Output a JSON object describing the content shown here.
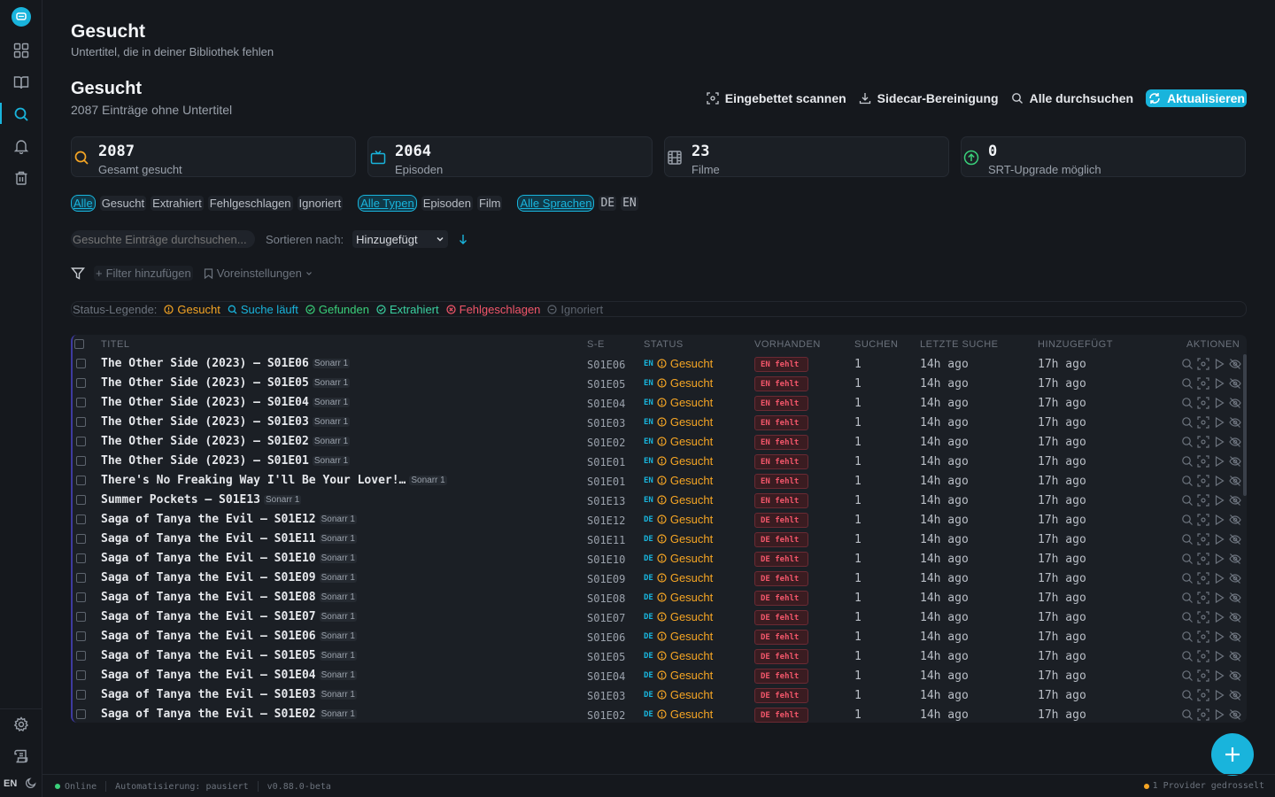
{
  "header": {
    "title": "Gesucht",
    "subtitle": "Untertitel, die in deiner Bibliothek fehlen"
  },
  "section": {
    "title": "Gesucht",
    "subtitle": "2087 Einträge ohne Untertitel"
  },
  "toolbar": {
    "scan_embedded": "Eingebettet scannen",
    "sidecar_cleanup": "Sidecar-Bereinigung",
    "search_all": "Alle durchsuchen",
    "refresh": "Aktualisieren"
  },
  "stats": [
    {
      "value": "2087",
      "label": "Gesamt gesucht"
    },
    {
      "value": "2064",
      "label": "Episoden"
    },
    {
      "value": "23",
      "label": "Filme"
    },
    {
      "value": "0",
      "label": "SRT-Upgrade möglich"
    }
  ],
  "filters": {
    "status": [
      "Alle",
      "Gesucht",
      "Extrahiert",
      "Fehlgeschlagen",
      "Ignoriert"
    ],
    "types": [
      "Alle Typen",
      "Episoden",
      "Film"
    ],
    "languages": [
      "Alle Sprachen",
      "DE",
      "EN"
    ]
  },
  "search": {
    "placeholder": "Gesuchte Einträge durchsuchen...",
    "sort_label": "Sortieren nach:",
    "sort_value": "Hinzugefügt"
  },
  "filterbar": {
    "add_filter": "Filter hinzufügen",
    "presets": "Voreinstellungen"
  },
  "legend": {
    "label": "Status-Legende:",
    "items": [
      {
        "label": "Gesucht",
        "color": "#f5a524"
      },
      {
        "label": "Suche läuft",
        "color": "#19b4dc"
      },
      {
        "label": "Gefunden",
        "color": "#3ad07a"
      },
      {
        "label": "Extrahiert",
        "color": "#3ad0a0"
      },
      {
        "label": "Fehlgeschlagen",
        "color": "#f2566a"
      },
      {
        "label": "Ignoriert",
        "color": "#5d646e"
      }
    ]
  },
  "table": {
    "columns": [
      "TITEL",
      "S-E",
      "STATUS",
      "VORHANDEN",
      "SUCHEN",
      "LETZTE SUCHE",
      "HINZUGEFÜGT",
      "AKTIONEN"
    ],
    "rows": [
      {
        "title": "The Other Side (2023) – S01E06",
        "source": "Sonarr 1",
        "se": "S01E06",
        "lang": "EN",
        "status": "Gesucht",
        "present": "EN fehlt",
        "searches": "1",
        "last": "14h ago",
        "added": "17h ago"
      },
      {
        "title": "The Other Side (2023) – S01E05",
        "source": "Sonarr 1",
        "se": "S01E05",
        "lang": "EN",
        "status": "Gesucht",
        "present": "EN fehlt",
        "searches": "1",
        "last": "14h ago",
        "added": "17h ago"
      },
      {
        "title": "The Other Side (2023) – S01E04",
        "source": "Sonarr 1",
        "se": "S01E04",
        "lang": "EN",
        "status": "Gesucht",
        "present": "EN fehlt",
        "searches": "1",
        "last": "14h ago",
        "added": "17h ago"
      },
      {
        "title": "The Other Side (2023) – S01E03",
        "source": "Sonarr 1",
        "se": "S01E03",
        "lang": "EN",
        "status": "Gesucht",
        "present": "EN fehlt",
        "searches": "1",
        "last": "14h ago",
        "added": "17h ago"
      },
      {
        "title": "The Other Side (2023) – S01E02",
        "source": "Sonarr 1",
        "se": "S01E02",
        "lang": "EN",
        "status": "Gesucht",
        "present": "EN fehlt",
        "searches": "1",
        "last": "14h ago",
        "added": "17h ago"
      },
      {
        "title": "The Other Side (2023) – S01E01",
        "source": "Sonarr 1",
        "se": "S01E01",
        "lang": "EN",
        "status": "Gesucht",
        "present": "EN fehlt",
        "searches": "1",
        "last": "14h ago",
        "added": "17h ago"
      },
      {
        "title": "There's No Freaking Way I'll Be Your Lover!…",
        "source": "Sonarr 1",
        "se": "S01E01",
        "lang": "EN",
        "status": "Gesucht",
        "present": "EN fehlt",
        "searches": "1",
        "last": "14h ago",
        "added": "17h ago"
      },
      {
        "title": "Summer Pockets – S01E13",
        "source": "Sonarr 1",
        "se": "S01E13",
        "lang": "EN",
        "status": "Gesucht",
        "present": "EN fehlt",
        "searches": "1",
        "last": "14h ago",
        "added": "17h ago"
      },
      {
        "title": "Saga of Tanya the Evil – S01E12",
        "source": "Sonarr 1",
        "se": "S01E12",
        "lang": "DE",
        "status": "Gesucht",
        "present": "DE fehlt",
        "searches": "1",
        "last": "14h ago",
        "added": "17h ago"
      },
      {
        "title": "Saga of Tanya the Evil – S01E11",
        "source": "Sonarr 1",
        "se": "S01E11",
        "lang": "DE",
        "status": "Gesucht",
        "present": "DE fehlt",
        "searches": "1",
        "last": "14h ago",
        "added": "17h ago"
      },
      {
        "title": "Saga of Tanya the Evil – S01E10",
        "source": "Sonarr 1",
        "se": "S01E10",
        "lang": "DE",
        "status": "Gesucht",
        "present": "DE fehlt",
        "searches": "1",
        "last": "14h ago",
        "added": "17h ago"
      },
      {
        "title": "Saga of Tanya the Evil – S01E09",
        "source": "Sonarr 1",
        "se": "S01E09",
        "lang": "DE",
        "status": "Gesucht",
        "present": "DE fehlt",
        "searches": "1",
        "last": "14h ago",
        "added": "17h ago"
      },
      {
        "title": "Saga of Tanya the Evil – S01E08",
        "source": "Sonarr 1",
        "se": "S01E08",
        "lang": "DE",
        "status": "Gesucht",
        "present": "DE fehlt",
        "searches": "1",
        "last": "14h ago",
        "added": "17h ago"
      },
      {
        "title": "Saga of Tanya the Evil – S01E07",
        "source": "Sonarr 1",
        "se": "S01E07",
        "lang": "DE",
        "status": "Gesucht",
        "present": "DE fehlt",
        "searches": "1",
        "last": "14h ago",
        "added": "17h ago"
      },
      {
        "title": "Saga of Tanya the Evil – S01E06",
        "source": "Sonarr 1",
        "se": "S01E06",
        "lang": "DE",
        "status": "Gesucht",
        "present": "DE fehlt",
        "searches": "1",
        "last": "14h ago",
        "added": "17h ago"
      },
      {
        "title": "Saga of Tanya the Evil – S01E05",
        "source": "Sonarr 1",
        "se": "S01E05",
        "lang": "DE",
        "status": "Gesucht",
        "present": "DE fehlt",
        "searches": "1",
        "last": "14h ago",
        "added": "17h ago"
      },
      {
        "title": "Saga of Tanya the Evil – S01E04",
        "source": "Sonarr 1",
        "se": "S01E04",
        "lang": "DE",
        "status": "Gesucht",
        "present": "DE fehlt",
        "searches": "1",
        "last": "14h ago",
        "added": "17h ago"
      },
      {
        "title": "Saga of Tanya the Evil – S01E03",
        "source": "Sonarr 1",
        "se": "S01E03",
        "lang": "DE",
        "status": "Gesucht",
        "present": "DE fehlt",
        "searches": "1",
        "last": "14h ago",
        "added": "17h ago"
      },
      {
        "title": "Saga of Tanya the Evil – S01E02",
        "source": "Sonarr 1",
        "se": "S01E02",
        "lang": "DE",
        "status": "Gesucht",
        "present": "DE fehlt",
        "searches": "1",
        "last": "14h ago",
        "added": "17h ago"
      }
    ]
  },
  "sidebar": {
    "icons": [
      "logo-icon",
      "dashboard-icon",
      "library-icon",
      "search-icon",
      "bell-icon",
      "trash-icon",
      "gear-icon",
      "logs-icon"
    ],
    "language": "EN"
  },
  "statusbar": {
    "online": "Online",
    "automation": "Automatisierung: pausiert",
    "version": "v0.88.0-beta",
    "throttled": "1 Provider gedrosselt"
  },
  "colors": {
    "accent": "#19b4dc",
    "wanted": "#f5a524",
    "missing": "#f2566a",
    "online": "#3ad07a"
  }
}
